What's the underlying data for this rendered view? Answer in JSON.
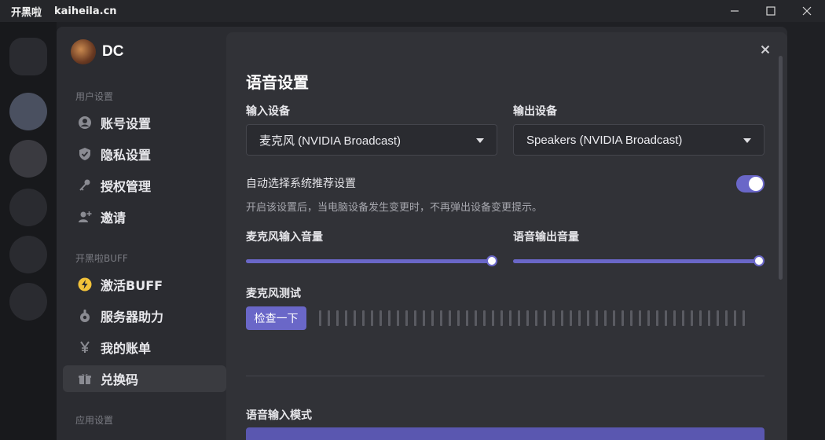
{
  "titlebar": {
    "app_name": "开黑啦",
    "app_url": "kaiheila.cn"
  },
  "sidebar": {
    "profile_name": "DC",
    "sections": [
      {
        "label": "用户设置",
        "items": [
          {
            "label": "账号设置",
            "icon": "user-icon"
          },
          {
            "label": "隐私设置",
            "icon": "shield-icon"
          },
          {
            "label": "授权管理",
            "icon": "key-icon"
          },
          {
            "label": "邀请",
            "icon": "add-user-icon"
          }
        ]
      },
      {
        "label": "开黑啦BUFF",
        "items": [
          {
            "label": "激活BUFF",
            "icon": "lightning-icon"
          },
          {
            "label": "服务器助力",
            "icon": "boost-icon"
          },
          {
            "label": "我的账单",
            "icon": "yen-icon"
          },
          {
            "label": "兑换码",
            "icon": "gift-icon",
            "active": true
          }
        ]
      },
      {
        "label": "应用设置",
        "items": []
      }
    ]
  },
  "voice": {
    "title": "语音设置",
    "input_device_label": "输入设备",
    "input_device_value": "麦克风 (NVIDIA Broadcast)",
    "output_device_label": "输出设备",
    "output_device_value": "Speakers (NVIDIA Broadcast)",
    "auto_select_label": "自动选择系统推荐设置",
    "auto_select_enabled": true,
    "auto_select_hint": "开启该设置后，当电脑设备发生变更时，不再弹出设备变更提示。",
    "mic_volume_label": "麦克风输入音量",
    "mic_volume_percent": 100,
    "output_volume_label": "语音输出音量",
    "output_volume_percent": 100,
    "mic_test_label": "麦克风测试",
    "mic_test_button": "检查一下",
    "input_mode_label": "语音输入模式"
  },
  "colors": {
    "accent": "#6a67c8",
    "background": "#313237",
    "sidebar": "#2b2c31"
  }
}
